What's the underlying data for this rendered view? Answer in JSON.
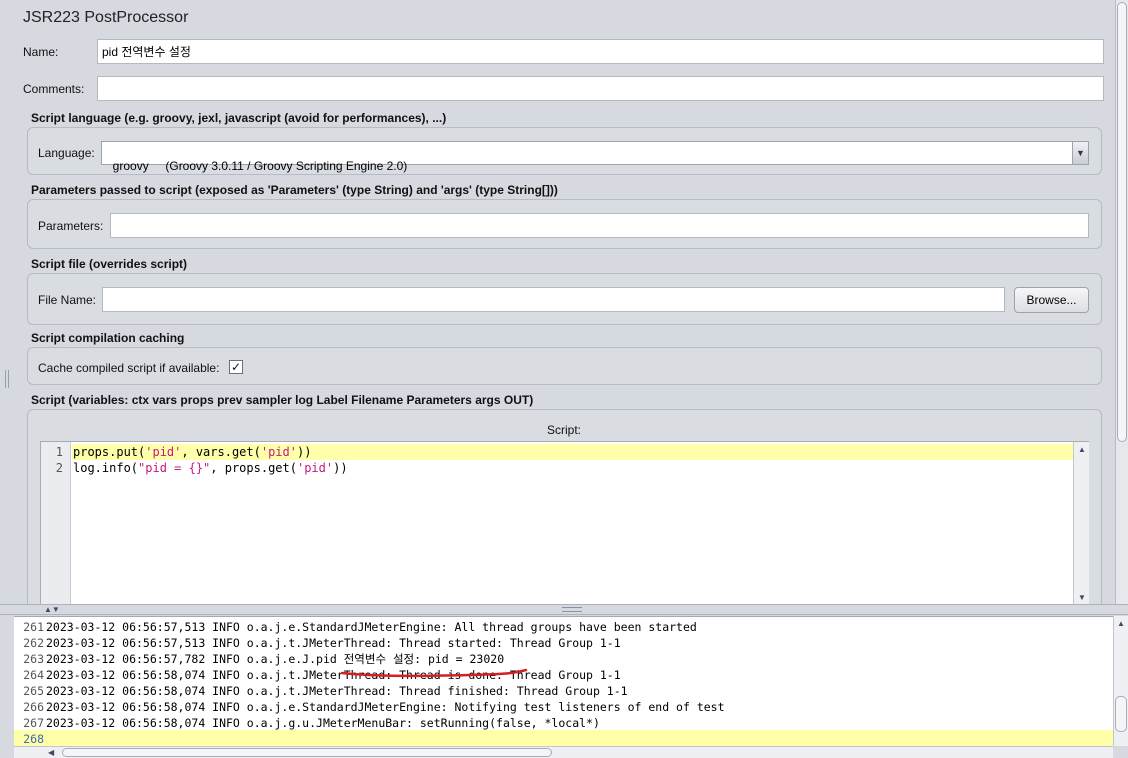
{
  "panel": {
    "title": "JSR223 PostProcessor"
  },
  "name": {
    "label": "Name:",
    "value": "pid 전역변수 설정"
  },
  "comments": {
    "label": "Comments:",
    "value": ""
  },
  "language_section": {
    "title": "Script language (e.g. groovy, jexl, javascript (avoid for performances), ...)",
    "label": "Language:",
    "value": "groovy     (Groovy 3.0.11 / Groovy Scripting Engine 2.0)"
  },
  "parameters_section": {
    "title": "Parameters passed to script (exposed as 'Parameters' (type String) and 'args' (type String[]))",
    "label": "Parameters:",
    "value": ""
  },
  "script_file_section": {
    "title": "Script file (overrides script)",
    "label": "File Name:",
    "value": "",
    "browse_label": "Browse..."
  },
  "caching_section": {
    "title": "Script compilation caching",
    "label": "Cache compiled script if available:",
    "checked": "✓"
  },
  "script_section": {
    "title": "Script (variables: ctx vars props prev sampler log Label Filename Parameters args OUT)",
    "editor_label": "Script:",
    "lines": [
      {
        "num": "1",
        "text": "props.put('pid', vars.get('pid'))"
      },
      {
        "num": "2",
        "text": "log.info(\"pid = {}\", props.get('pid'))"
      }
    ]
  },
  "log": {
    "lines": [
      {
        "num": "261",
        "text": "2023-03-12 06:56:57,513 INFO o.a.j.e.StandardJMeterEngine: All thread groups have been started"
      },
      {
        "num": "262",
        "text": "2023-03-12 06:56:57,513 INFO o.a.j.t.JMeterThread: Thread started: Thread Group 1-1"
      },
      {
        "num": "263",
        "text": "2023-03-12 06:56:57,782 INFO o.a.j.e.J.pid 전역변수 설정: pid = 23020"
      },
      {
        "num": "264",
        "text": "2023-03-12 06:56:58,074 INFO o.a.j.t.JMeterThread: Thread is done: Thread Group 1-1"
      },
      {
        "num": "265",
        "text": "2023-03-12 06:56:58,074 INFO o.a.j.t.JMeterThread: Thread finished: Thread Group 1-1"
      },
      {
        "num": "266",
        "text": "2023-03-12 06:56:58,074 INFO o.a.j.e.StandardJMeterEngine: Notifying test listeners of end of test"
      },
      {
        "num": "267",
        "text": "2023-03-12 06:56:58,074 INFO o.a.j.g.u.JMeterMenuBar: setRunning(false, *local*)"
      },
      {
        "num": "268",
        "text": ""
      }
    ]
  },
  "colors": {
    "highlight_line": "#ffffaa",
    "underline": "#d42020",
    "string": "#c41a7f"
  }
}
